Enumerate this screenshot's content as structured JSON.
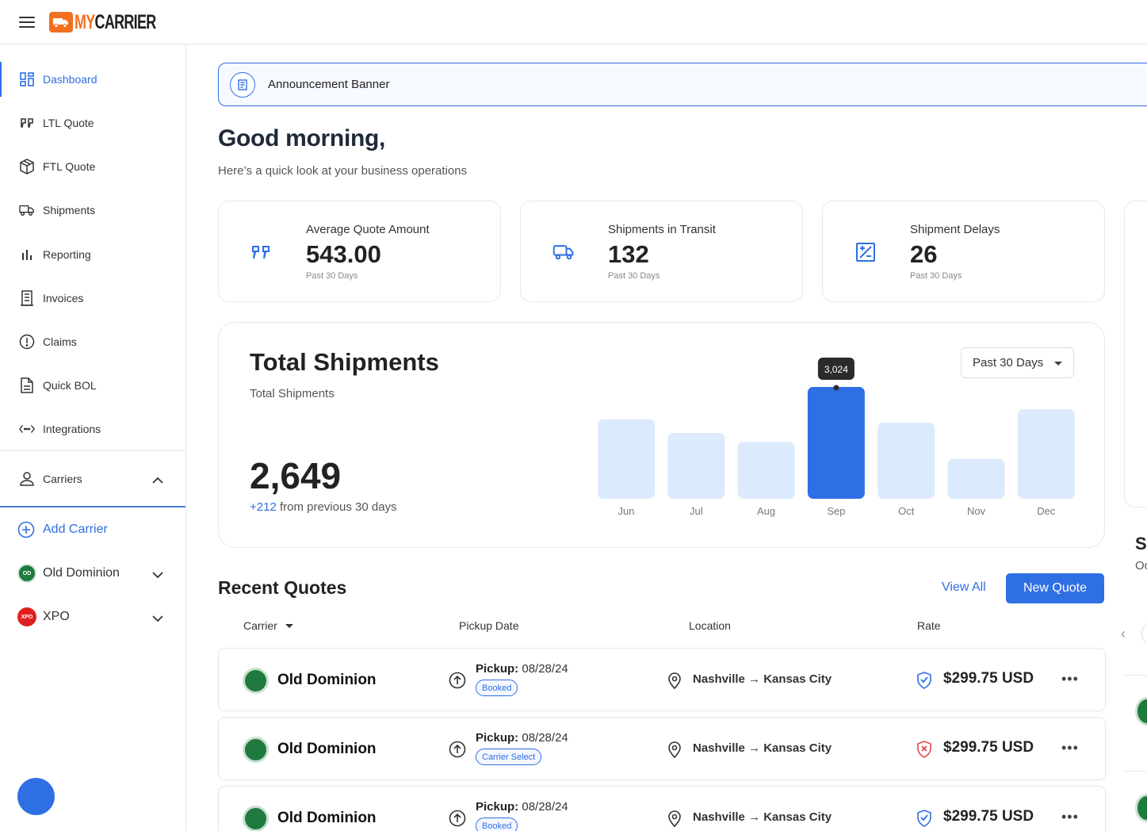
{
  "brand": {
    "my": "MY",
    "carrier": "CARRIER"
  },
  "sidebar": {
    "items": [
      {
        "label": "Dashboard",
        "icon": "dashboard-icon"
      },
      {
        "label": "LTL Quote",
        "icon": "quote-icon"
      },
      {
        "label": "FTL Quote",
        "icon": "box-icon"
      },
      {
        "label": "Shipments",
        "icon": "truck-icon"
      },
      {
        "label": "Reporting",
        "icon": "bar-chart-icon"
      },
      {
        "label": "Invoices",
        "icon": "receipt-icon"
      },
      {
        "label": "Claims",
        "icon": "alert-circle-icon"
      },
      {
        "label": "Quick BOL",
        "icon": "document-icon"
      },
      {
        "label": "Integrations",
        "icon": "code-icon"
      }
    ],
    "carriers_label": "Carriers",
    "add_carrier": "Add Carrier",
    "carriers": [
      {
        "name": "Old Dominion",
        "badge": "OD"
      },
      {
        "name": "XPO",
        "badge": "XPO"
      }
    ]
  },
  "banner": {
    "text": "Announcement Banner"
  },
  "greeting": {
    "title": "Good morning,",
    "subtitle": "Here’s a quick look at your business operations"
  },
  "stats": [
    {
      "label": "Average Quote Amount",
      "value": "543.00",
      "sub": "Past 30 Days",
      "icon": "quote-icon"
    },
    {
      "label": "Shipments in Transit",
      "value": "132",
      "sub": "Past 30 Days",
      "icon": "truck-icon"
    },
    {
      "label": "Shipment Delays",
      "value": "26",
      "sub": "Past 30 Days",
      "icon": "delay-icon"
    }
  ],
  "total_shipments": {
    "title": "Total Shipments",
    "subtitle": "Total Shipments",
    "total": "2,649",
    "change_value": "+212",
    "change_text": " from previous 30 days",
    "range": "Past 30 Days",
    "tooltip": "3,024"
  },
  "chart_data": {
    "type": "bar",
    "categories": [
      "Jun",
      "Jul",
      "Aug",
      "Sep",
      "Oct",
      "Nov",
      "Dec"
    ],
    "values": [
      2150,
      1780,
      1540,
      3024,
      2060,
      1080,
      2420
    ],
    "highlight": "Sep",
    "title": "Total Shipments",
    "colors": {
      "bar": "#dceafd",
      "highlight": "#2f6fe4"
    }
  },
  "recent_quotes": {
    "title": "Recent Quotes",
    "view_all": "View All",
    "new_quote": "New Quote",
    "columns": [
      "Carrier",
      "Pickup Date",
      "Location",
      "Rate"
    ],
    "rows": [
      {
        "carrier": "Old Dominion",
        "pickup_label": "Pickup:",
        "pickup_date": "08/28/24",
        "status": "Booked",
        "from": "Nashville",
        "to": "Kansas City",
        "rate": "$299.75 USD",
        "shield": "verified"
      },
      {
        "carrier": "Old Dominion",
        "pickup_label": "Pickup:",
        "pickup_date": "08/28/24",
        "status": "Carrier Select",
        "from": "Nashville",
        "to": "Kansas City",
        "rate": "$299.75 USD",
        "shield": "rejected"
      },
      {
        "carrier": "Old Dominion",
        "pickup_label": "Pickup:",
        "pickup_date": "08/28/24",
        "status": "Booked",
        "from": "Nashville",
        "to": "Kansas City",
        "rate": "$299.75 USD",
        "shield": "verified"
      }
    ]
  },
  "right_panel": {
    "title_initial": "S",
    "sub_initial": "Oc"
  },
  "colors": {
    "accent": "#2f6fe4",
    "brand_orange": "#f37021",
    "od_green": "#1f7a3e",
    "xpo_red": "#e02020",
    "reject_red": "#e04848"
  }
}
